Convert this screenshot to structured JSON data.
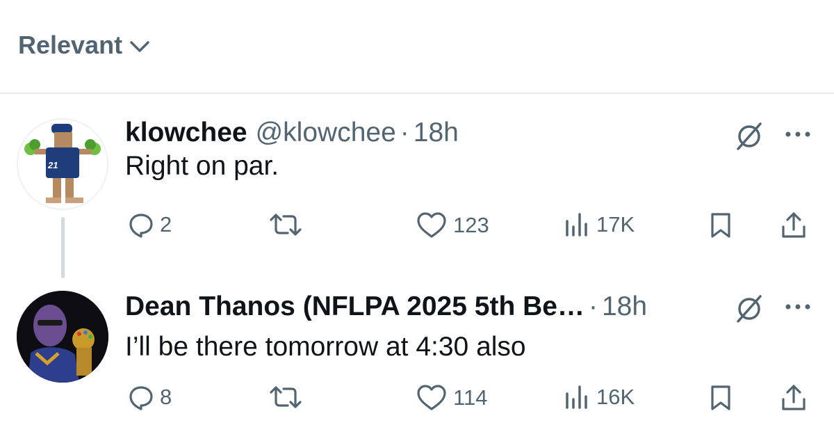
{
  "sort": {
    "label": "Relevant"
  },
  "replies": [
    {
      "name": "klowchee",
      "handle": "@klowchee",
      "time": "18h",
      "text": "Right on par.",
      "stats": {
        "replies": "2",
        "likes": "123",
        "views": "17K"
      }
    },
    {
      "name": "Dean Thanos (NFLPA 2025 5th Be…",
      "handle": "",
      "time": "18h",
      "text": "I’ll be there tomorrow at 4:30 also",
      "stats": {
        "replies": "8",
        "likes": "114",
        "views": "16K"
      }
    }
  ],
  "colors": {
    "secondary_text": "#536471",
    "primary_text": "#0f1419",
    "divider": "#e7e9ea"
  },
  "icons": [
    "chevron-down-icon",
    "reply-icon",
    "retweet-icon",
    "like-icon",
    "views-icon",
    "bookmark-icon",
    "share-icon",
    "grok-icon",
    "more-icon"
  ]
}
